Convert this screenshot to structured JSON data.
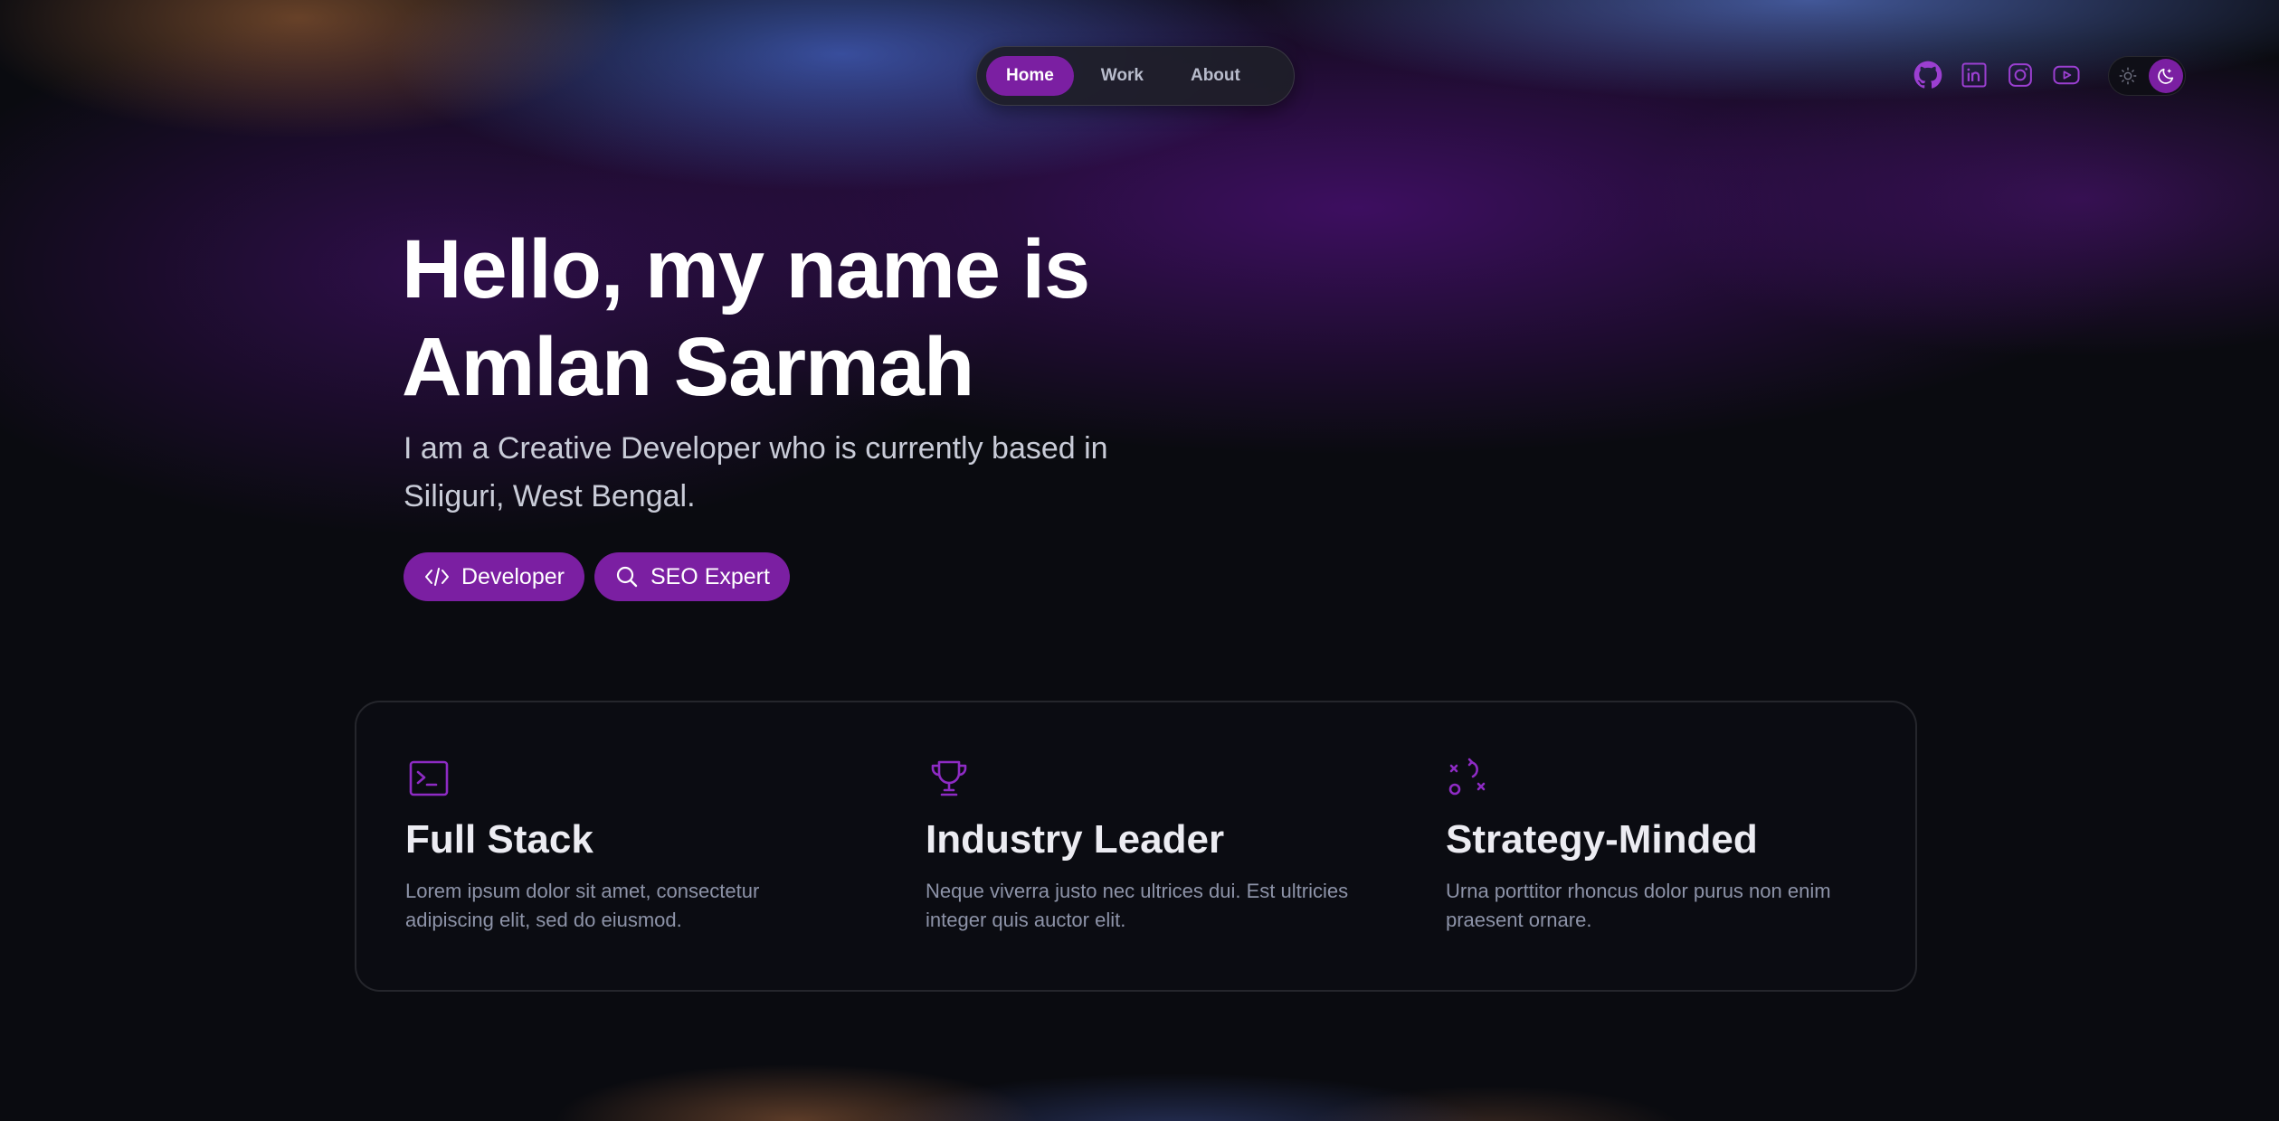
{
  "nav": {
    "items": [
      {
        "label": "Home",
        "active": true
      },
      {
        "label": "Work",
        "active": false
      },
      {
        "label": "About",
        "active": false
      }
    ]
  },
  "social": [
    "github-icon",
    "linkedin-icon",
    "instagram-icon",
    "youtube-icon"
  ],
  "theme": {
    "mode": "dark"
  },
  "hero": {
    "title_line1": "Hello, my name is",
    "title_line2": "Amlan Sarmah",
    "subtitle": "I am a Creative Developer who is currently based in Siliguri, West Bengal.",
    "tags": [
      {
        "label": "Developer",
        "icon": "code-icon"
      },
      {
        "label": "SEO Expert",
        "icon": "search-icon"
      }
    ]
  },
  "features": [
    {
      "title": "Full Stack",
      "text": "Lorem ipsum dolor sit amet, consectetur adipiscing elit, sed do eiusmod.",
      "icon": "terminal-icon"
    },
    {
      "title": "Industry Leader",
      "text": "Neque viverra justo nec ultrices dui. Est ultricies integer quis auctor elit.",
      "icon": "trophy-icon"
    },
    {
      "title": "Strategy-Minded",
      "text": "Urna porttitor rhoncus dolor purus non enim praesent ornare.",
      "icon": "strategy-icon"
    }
  ],
  "colors": {
    "accent": "#7b1fa2",
    "background": "#0a0b10"
  }
}
